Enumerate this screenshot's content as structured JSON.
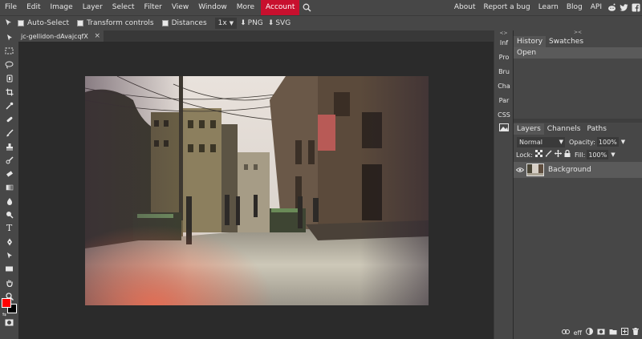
{
  "menu": {
    "items": [
      "File",
      "Edit",
      "Image",
      "Layer",
      "Select",
      "Filter",
      "View",
      "Window",
      "More"
    ],
    "account": "Account",
    "right": [
      "About",
      "Report a bug",
      "Learn",
      "Blog",
      "API"
    ]
  },
  "options": {
    "auto_select": "Auto-Select",
    "transform_controls": "Transform controls",
    "distances": "Distances",
    "zoom": "1x",
    "png": "PNG",
    "svg": "SVG"
  },
  "document": {
    "tab_title": "jc-gellidon-dAvajcqfX",
    "close": "×"
  },
  "minipanels": [
    "Inf",
    "Pro",
    "Bru",
    "Cha",
    "Par",
    "CSS"
  ],
  "panels": {
    "top_tabs": [
      "History",
      "Swatches"
    ],
    "history": [
      "Open"
    ],
    "layer_tabs": [
      "Layers",
      "Channels",
      "Paths"
    ],
    "blend_mode": "Normal",
    "opacity_label": "Opacity:",
    "opacity": "100%",
    "lock_label": "Lock:",
    "fill_label": "Fill:",
    "fill": "100%",
    "layers": [
      {
        "name": "Background"
      }
    ],
    "footer_eff": "eff"
  },
  "colors": {
    "foreground": "#ff0000",
    "background": "#000000",
    "accent": "#c8102e"
  }
}
